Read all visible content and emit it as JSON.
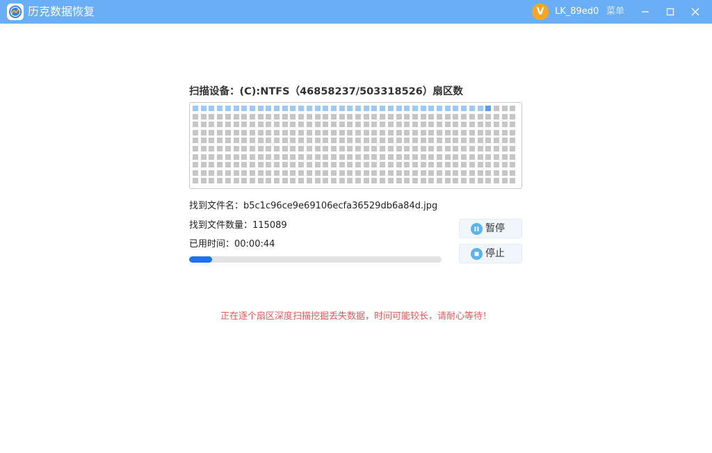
{
  "titlebar": {
    "app_title": "历克数据恢复",
    "user_initial": "V",
    "username": "LK_89ed0",
    "menu_label": "菜单",
    "icons": {
      "logo": "app-logo-icon",
      "minimize": "minimize-icon",
      "maximize": "maximize-icon",
      "close": "close-icon"
    }
  },
  "scan": {
    "title": "扫描设备：(C):NTFS（46858237/503318526）扇区数",
    "grid": {
      "rows": 10,
      "cols": 40,
      "scanned_cells": 36,
      "current_cell": 36
    },
    "found_file_label": "找到文件名：b5c1c96ce9e69106ecfa36529db6a84d.jpg",
    "found_count_label": "找到文件数量：115089",
    "elapsed_label": "已用时间：00:00:44",
    "progress_percent": 9
  },
  "controls": {
    "pause_label": "暂停",
    "stop_label": "停止",
    "pause_icon": "pause-icon",
    "stop_icon": "stop-icon"
  },
  "warning_text": "正在逐个扇区深度扫描挖掘丢失数据，时间可能较长，请耐心等待！",
  "colors": {
    "titlebar": "#6aaef7",
    "accent": "#1a73e8",
    "sector_done": "#9ccaf5",
    "sector_current": "#5b9ee8",
    "sector_pending": "#c6c6c6",
    "warning": "#e45a5a",
    "avatar": "#f5a623"
  }
}
